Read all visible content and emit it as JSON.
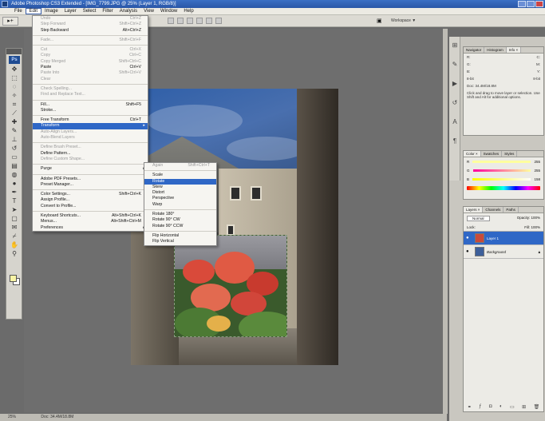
{
  "window": {
    "title": "Adobe Photoshop CS3 Extended - [IMG_7799.JPG @ 25% (Layer 1, RGB/8)]"
  },
  "menubar": {
    "items": [
      "File",
      "Edit",
      "Image",
      "Layer",
      "Select",
      "Filter",
      "Analysis",
      "View",
      "Window",
      "Help"
    ],
    "active_index": 1
  },
  "optionsbar": {
    "workspace_label": "Workspace ▼"
  },
  "edit_menu": {
    "items": [
      {
        "label": "Undo",
        "shortcut": "Ctrl+Z",
        "dim": true
      },
      {
        "label": "Step Forward",
        "shortcut": "Shift+Ctrl+Z",
        "dim": true
      },
      {
        "label": "Step Backward",
        "shortcut": "Alt+Ctrl+Z",
        "dim": false
      },
      {
        "sep": true
      },
      {
        "label": "Fade...",
        "shortcut": "Shift+Ctrl+F",
        "dim": true
      },
      {
        "sep": true
      },
      {
        "label": "Cut",
        "shortcut": "Ctrl+X",
        "dim": true
      },
      {
        "label": "Copy",
        "shortcut": "Ctrl+C",
        "dim": true
      },
      {
        "label": "Copy Merged",
        "shortcut": "Shift+Ctrl+C",
        "dim": true
      },
      {
        "label": "Paste",
        "shortcut": "Ctrl+V",
        "dim": false
      },
      {
        "label": "Paste Into",
        "shortcut": "Shift+Ctrl+V",
        "dim": true
      },
      {
        "label": "Clear",
        "shortcut": "",
        "dim": true
      },
      {
        "sep": true
      },
      {
        "label": "Check Spelling...",
        "shortcut": "",
        "dim": true
      },
      {
        "label": "Find and Replace Text...",
        "shortcut": "",
        "dim": true
      },
      {
        "sep": true
      },
      {
        "label": "Fill...",
        "shortcut": "Shift+F5",
        "dim": false
      },
      {
        "label": "Stroke...",
        "shortcut": "",
        "dim": false
      },
      {
        "sep": true
      },
      {
        "label": "Free Transform",
        "shortcut": "Ctrl+T",
        "dim": false
      },
      {
        "label": "Transform",
        "shortcut": "",
        "dim": false,
        "highlight": true,
        "submenu": true
      },
      {
        "label": "Auto-Align Layers...",
        "shortcut": "",
        "dim": true
      },
      {
        "label": "Auto-Blend Layers",
        "shortcut": "",
        "dim": true
      },
      {
        "sep": true
      },
      {
        "label": "Define Brush Preset...",
        "shortcut": "",
        "dim": true
      },
      {
        "label": "Define Pattern...",
        "shortcut": "",
        "dim": false
      },
      {
        "label": "Define Custom Shape...",
        "shortcut": "",
        "dim": true
      },
      {
        "sep": true
      },
      {
        "label": "Purge",
        "shortcut": "",
        "dim": false,
        "submenu": true
      },
      {
        "sep": true
      },
      {
        "label": "Adobe PDF Presets...",
        "shortcut": "",
        "dim": false
      },
      {
        "label": "Preset Manager...",
        "shortcut": "",
        "dim": false
      },
      {
        "sep": true
      },
      {
        "label": "Color Settings...",
        "shortcut": "Shift+Ctrl+K",
        "dim": false
      },
      {
        "label": "Assign Profile...",
        "shortcut": "",
        "dim": false
      },
      {
        "label": "Convert to Profile...",
        "shortcut": "",
        "dim": false
      },
      {
        "sep": true
      },
      {
        "label": "Keyboard Shortcuts...",
        "shortcut": "Alt+Shift+Ctrl+K",
        "dim": false
      },
      {
        "label": "Menus...",
        "shortcut": "Alt+Shift+Ctrl+M",
        "dim": false
      },
      {
        "label": "Preferences",
        "shortcut": "",
        "dim": false,
        "submenu": true
      }
    ]
  },
  "transform_submenu": {
    "items": [
      {
        "label": "Again",
        "shortcut": "Shift+Ctrl+T",
        "dim": true
      },
      {
        "sep": true
      },
      {
        "label": "Scale",
        "shortcut": "",
        "dim": false
      },
      {
        "label": "Rotate",
        "shortcut": "",
        "dim": false,
        "highlight": true
      },
      {
        "label": "Skew",
        "shortcut": "",
        "dim": false
      },
      {
        "label": "Distort",
        "shortcut": "",
        "dim": false
      },
      {
        "label": "Perspective",
        "shortcut": "",
        "dim": false
      },
      {
        "label": "Warp",
        "shortcut": "",
        "dim": false
      },
      {
        "sep": true
      },
      {
        "label": "Rotate 180°",
        "shortcut": "",
        "dim": false
      },
      {
        "label": "Rotate 90° CW",
        "shortcut": "",
        "dim": false
      },
      {
        "label": "Rotate 90° CCW",
        "shortcut": "",
        "dim": false
      },
      {
        "sep": true
      },
      {
        "label": "Flip Horizontal",
        "shortcut": "",
        "dim": false
      },
      {
        "label": "Flip Vertical",
        "shortcut": "",
        "dim": false
      }
    ]
  },
  "panels": {
    "info_tabs": [
      "Navigator",
      "Histogram",
      "Info ×"
    ],
    "info_rows": [
      [
        "R:",
        "C:"
      ],
      [
        "G:",
        "M:"
      ],
      [
        "B:",
        "Y:"
      ],
      [
        "8-bit",
        "8-bit"
      ]
    ],
    "info_doc": "Doc: 34.4M/18.8M",
    "info_hint": "Click and drag to move layer or selection. Use Shift and Alt for additional options.",
    "color_tabs": [
      "Color ×",
      "Swatches",
      "Styles"
    ],
    "color_rows": [
      [
        "R",
        "255"
      ],
      [
        "G",
        "255"
      ],
      [
        "B",
        "158"
      ]
    ],
    "layers_tabs": [
      "Layers ×",
      "Channels",
      "Paths"
    ],
    "blend_mode": "Normal",
    "opacity_label": "Opacity: 100%",
    "lock_label": "Lock:",
    "fill_label": "Fill: 100%",
    "layers": [
      {
        "name": "Layer 1",
        "selected": true
      },
      {
        "name": "Background",
        "selected": false
      }
    ]
  },
  "status": {
    "zoom": "25%",
    "doc": "Doc: 34.4M/18.8M"
  },
  "colors": {
    "highlight": "#2f67c6",
    "foreground_swatch": "#f7f3a4"
  }
}
